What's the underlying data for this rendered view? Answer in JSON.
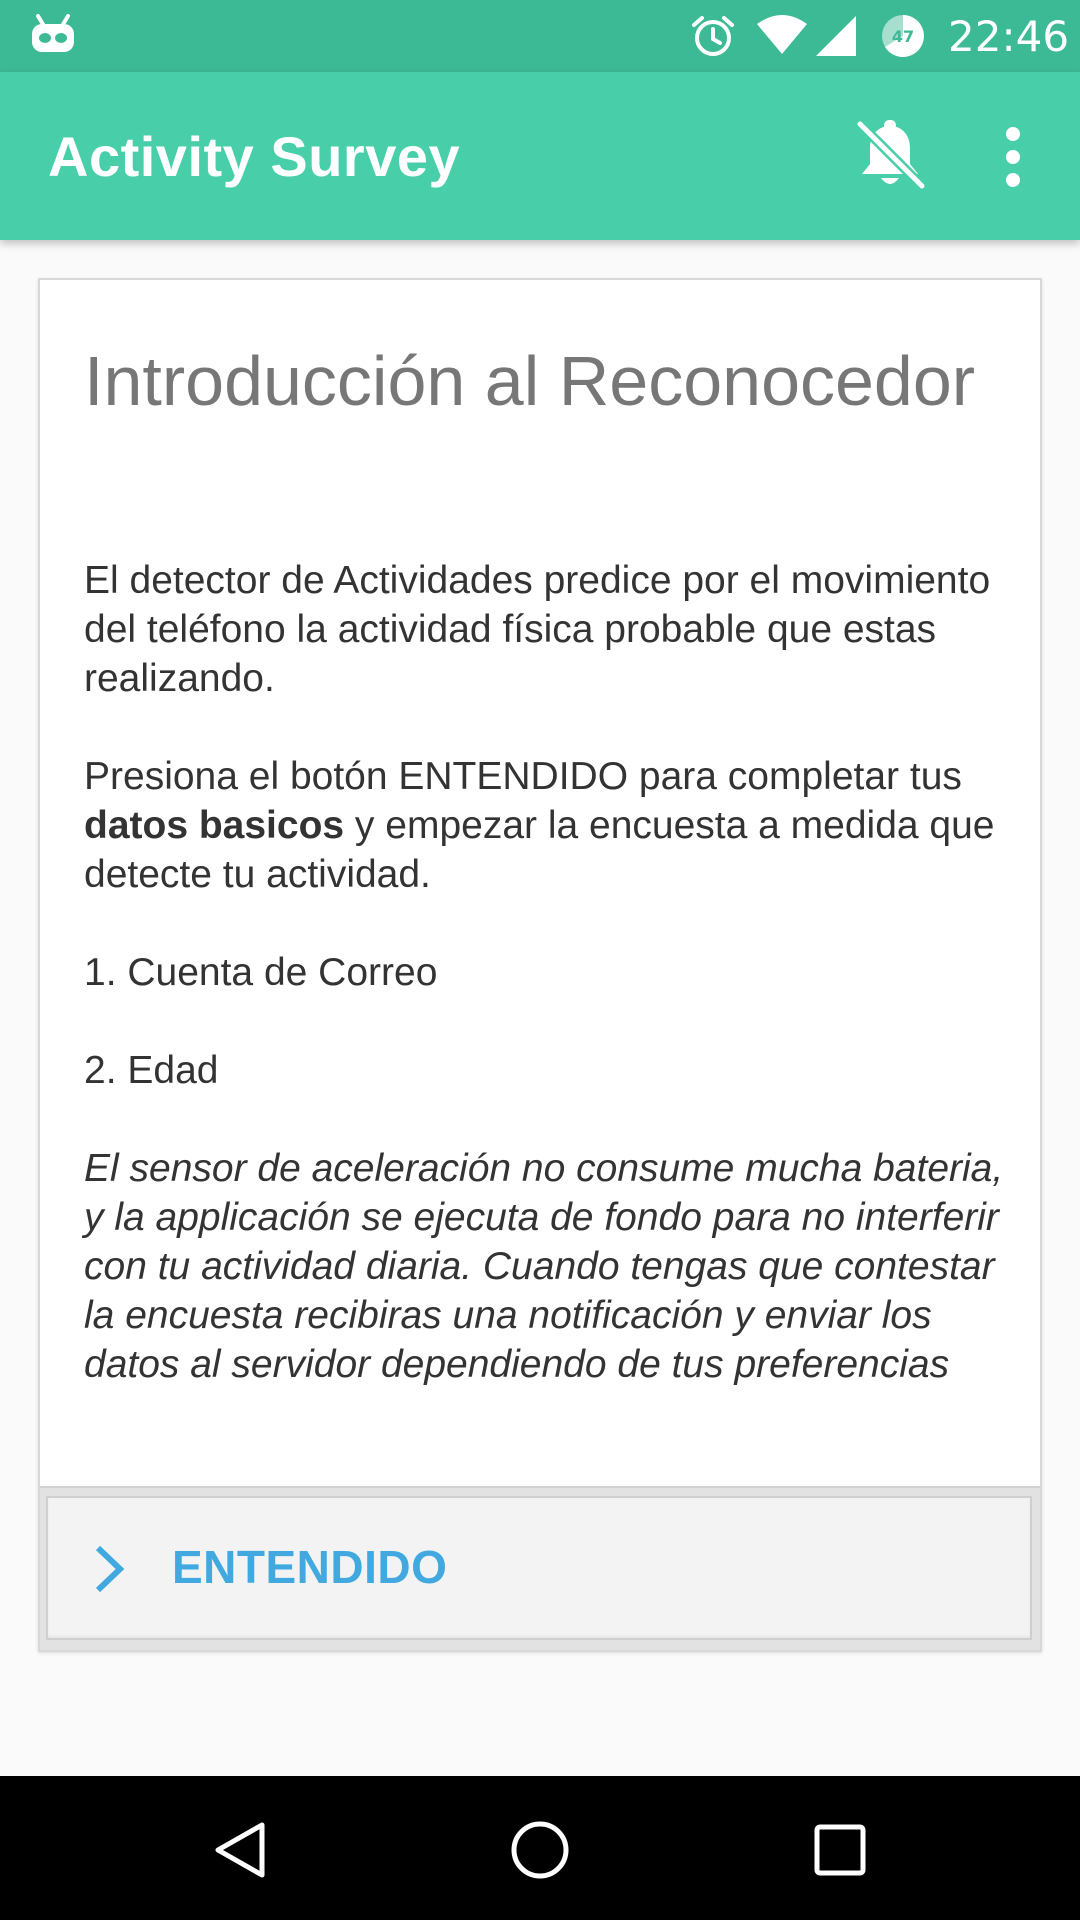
{
  "status_bar": {
    "time": "22:46",
    "battery_level": "47",
    "icons": [
      "app-notification-icon",
      "alarm-icon",
      "wifi-icon",
      "signal-icon",
      "battery-icon"
    ]
  },
  "app_bar": {
    "title": "Activity Survey",
    "actions": [
      "notifications-off-icon",
      "more-vert-icon"
    ]
  },
  "card": {
    "heading": "Introducción al Reconocedor",
    "paragraph_1": "El detector de Actividades predice por el movimiento del teléfono la actividad física probable que estas realizando.",
    "paragraph_2_before": "Presiona el botón ENTENDIDO para completar tus ",
    "paragraph_2_bold": "datos basicos",
    "paragraph_2_after": " y empezar la encuesta a medida que detecte tu actividad.",
    "item_1": "1. Cuenta de Correo",
    "item_2": "2. Edad",
    "note": "El sensor de aceleración no consume mucha bateria, y la applicación se ejecuta de fondo para no interferir con tu actividad diaria. Cuando tengas que contestar la encuesta recibiras una notificación y enviar los datos al servidor dependiendo de tus preferencias",
    "button_label": "ENTENDIDO"
  },
  "nav_bar": {
    "buttons": [
      "back-icon",
      "home-icon",
      "recents-icon"
    ]
  },
  "colors": {
    "status_bar": "#3cb995",
    "app_bar": "#48cfaa",
    "button_text": "#42a9e0",
    "heading": "#777777"
  }
}
